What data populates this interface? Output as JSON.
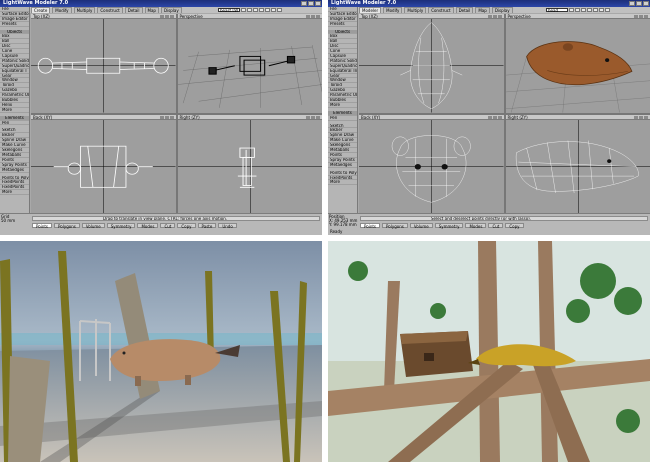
{
  "top_left": {
    "title": "LightWave Modeler 7.0",
    "tabs": [
      "Create",
      "Modify",
      "Multiply",
      "Construct",
      "Detail",
      "Map",
      "Display"
    ],
    "active_tab": 0,
    "layer": "beast.LW",
    "sidebar": [
      {
        "label": "File",
        "head": false
      },
      {
        "label": "Surface Editor",
        "head": false
      },
      {
        "label": "Image Editor",
        "head": false
      },
      {
        "label": "Presets",
        "head": false
      },
      {
        "label": "",
        "gap": true
      },
      {
        "label": "Objects",
        "head": true
      },
      {
        "label": "Box",
        "head": false
      },
      {
        "label": "Ball",
        "head": false
      },
      {
        "label": "Disc",
        "head": false
      },
      {
        "label": "Cone",
        "head": false
      },
      {
        "label": "Capsule",
        "head": false
      },
      {
        "label": "Platonic Solid",
        "head": false
      },
      {
        "label": "SuperQuadric",
        "head": false
      },
      {
        "label": "Equilateral T",
        "head": false
      },
      {
        "label": "Gear",
        "head": false
      },
      {
        "label": "Window",
        "head": false
      },
      {
        "label": "Toroid",
        "head": false
      },
      {
        "label": "Gazebo",
        "head": false
      },
      {
        "label": "Parametric Obj",
        "head": false
      },
      {
        "label": "Bubbles",
        "head": false
      },
      {
        "label": "Helix",
        "head": false
      },
      {
        "label": "More",
        "head": false
      },
      {
        "label": "",
        "gap": true
      },
      {
        "label": "Elements",
        "head": true
      },
      {
        "label": "Pen",
        "head": false
      },
      {
        "label": "",
        "gap": true
      },
      {
        "label": "Sketch",
        "head": false
      },
      {
        "label": "Bezier",
        "head": false
      },
      {
        "label": "Spline Draw",
        "head": false
      },
      {
        "label": "Make Curve",
        "head": false
      },
      {
        "label": "Skelegons",
        "head": false
      },
      {
        "label": "Metaballs",
        "head": false
      },
      {
        "label": "Points",
        "head": false
      },
      {
        "label": "Spray Points",
        "head": false
      },
      {
        "label": "Metaedges",
        "head": false
      },
      {
        "label": "",
        "gap": true
      },
      {
        "label": "Points to Polys",
        "head": false
      },
      {
        "label": "FixedPoints",
        "head": false
      },
      {
        "label": "FixedPoints",
        "head": false
      },
      {
        "label": "More",
        "head": false
      }
    ],
    "viewports": [
      {
        "label": "Top",
        "mode": "(XZ)"
      },
      {
        "label": "Perspective",
        "mode": ""
      },
      {
        "label": "Back",
        "mode": "(XY)"
      },
      {
        "label": "Right",
        "mode": "(ZY)"
      }
    ],
    "grid": [
      "Grid",
      "50 mm"
    ],
    "hint": "Drag to translate in view plane. CTRL: forces one axis motion.",
    "modes": [
      "Points",
      "Polygons",
      "Volume",
      "Symmetry",
      "Modes",
      "Cut",
      "Copy",
      "Paste",
      "Undo"
    ],
    "active_mode": 0
  },
  "top_right": {
    "title": "LightWave Modeler 7.0",
    "tabs": [
      "Modeler",
      "Modify",
      "Multiply",
      "Construct",
      "Detail",
      "Map",
      "Display"
    ],
    "active_tab": 0,
    "layer": "head",
    "sidebar": [
      {
        "label": "File",
        "head": false
      },
      {
        "label": "Surface Editor",
        "head": false
      },
      {
        "label": "Image Editor",
        "head": false
      },
      {
        "label": "Presets",
        "head": false
      },
      {
        "label": "",
        "gap": true
      },
      {
        "label": "Objects",
        "head": true
      },
      {
        "label": "Box",
        "head": false
      },
      {
        "label": "Ball",
        "head": false
      },
      {
        "label": "Disc",
        "head": false
      },
      {
        "label": "Cone",
        "head": false
      },
      {
        "label": "Capsule",
        "head": false
      },
      {
        "label": "Platonic Solid",
        "head": false
      },
      {
        "label": "SuperQuadric",
        "head": false
      },
      {
        "label": "Equilateral Tri",
        "head": false
      },
      {
        "label": "Gear",
        "head": false
      },
      {
        "label": "Window",
        "head": false
      },
      {
        "label": "Toroid",
        "head": false
      },
      {
        "label": "Gazebo",
        "head": false
      },
      {
        "label": "Parametric Obj",
        "head": false
      },
      {
        "label": "Bubbles",
        "head": false
      },
      {
        "label": "More",
        "head": false
      },
      {
        "label": "",
        "gap": true
      },
      {
        "label": "Elements",
        "head": true
      },
      {
        "label": "Pen",
        "head": false
      },
      {
        "label": "",
        "gap": true
      },
      {
        "label": "Sketch",
        "head": false
      },
      {
        "label": "Bezier",
        "head": false
      },
      {
        "label": "Spline Draw",
        "head": false
      },
      {
        "label": "Make Curve",
        "head": false
      },
      {
        "label": "Skelegons",
        "head": false
      },
      {
        "label": "Metaballs",
        "head": false
      },
      {
        "label": "Points",
        "head": false
      },
      {
        "label": "Spray Points",
        "head": false
      },
      {
        "label": "Metaedges",
        "head": false
      },
      {
        "label": "",
        "gap": true
      },
      {
        "label": "Points to Polys",
        "head": false
      },
      {
        "label": "FixedPoints",
        "head": false
      },
      {
        "label": "More",
        "head": false
      }
    ],
    "viewports": [
      {
        "label": "Top",
        "mode": "(XZ)"
      },
      {
        "label": "Perspective",
        "mode": ""
      },
      {
        "label": "Back",
        "mode": "(XY)"
      },
      {
        "label": "Right",
        "mode": "(ZY)"
      }
    ],
    "position": [
      "Position",
      "X: 49.253 mm",
      "Y: 99.178 mm",
      "Z: 37.264 mm"
    ],
    "grid": [
      "Grid",
      "50 mm"
    ],
    "hint": "Select and deselect points directly (or with lasso).",
    "modes": [
      "Points",
      "Polygons",
      "Volume",
      "Symmetry",
      "Modes",
      "Cut",
      "Copy"
    ],
    "active_mode": 0,
    "status": "Ready"
  }
}
